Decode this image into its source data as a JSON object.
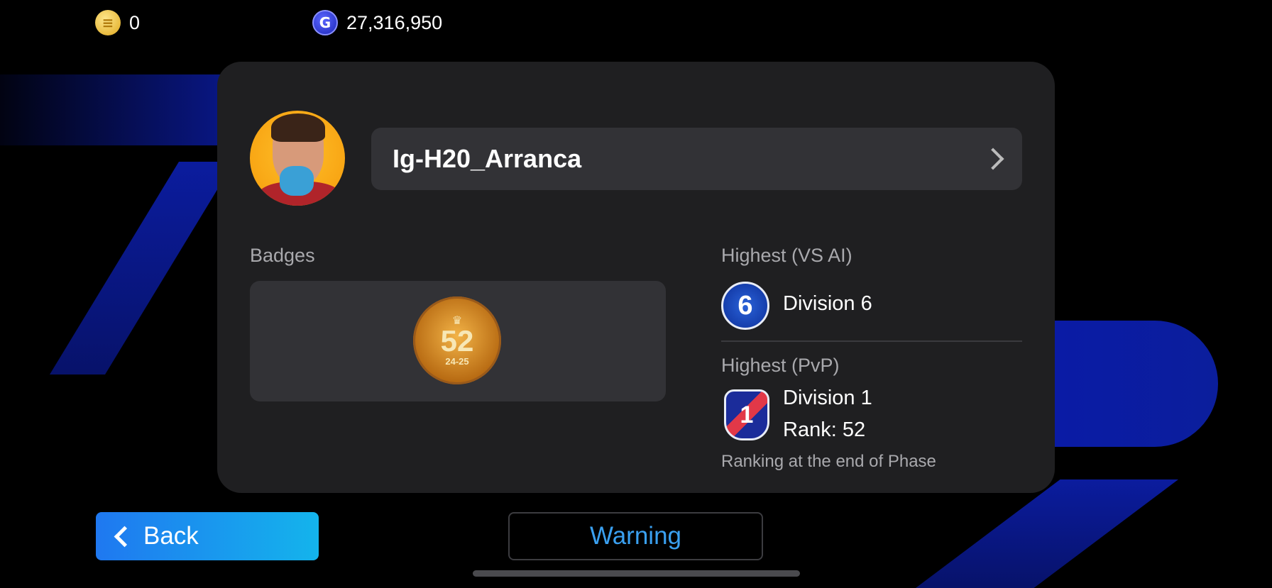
{
  "currencies": {
    "coins": {
      "value": "0",
      "icon": "coin-icon"
    },
    "gp": {
      "value": "27,316,950",
      "icon": "gp-icon"
    }
  },
  "profile": {
    "name": "Ig-H20_Arranca",
    "avatar": "player-avatar"
  },
  "badges": {
    "label": "Badges",
    "badge_number": "52",
    "badge_season": "24-25"
  },
  "highest_ai": {
    "label": "Highest (VS AI)",
    "division_number": "6",
    "division": "Division 6"
  },
  "highest_pvp": {
    "label": "Highest (PvP)",
    "division_number": "1",
    "division": "Division 1",
    "rank": "Rank: 52",
    "note": "Ranking at the end of Phase"
  },
  "buttons": {
    "back": "Back",
    "warning": "Warning"
  },
  "colors": {
    "accent_blue": "#1f78f0",
    "warning_text": "#3aa0f0",
    "card_bg": "#1f1f21"
  }
}
